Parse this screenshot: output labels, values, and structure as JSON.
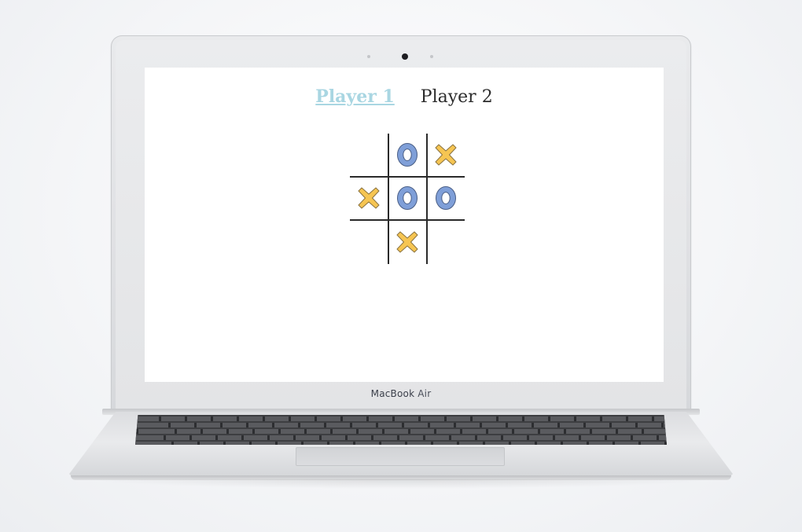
{
  "device": {
    "brand": "MacBook",
    "model": "Air"
  },
  "game": {
    "players": [
      {
        "label": "Player 1",
        "active": true
      },
      {
        "label": "Player 2",
        "active": false
      }
    ],
    "board": [
      [
        "",
        "O",
        "X"
      ],
      [
        "X",
        "O",
        "O"
      ],
      [
        "",
        "X",
        ""
      ]
    ],
    "colors": {
      "x_fill": "#f6c552",
      "o_fill": "#7f9fd8",
      "active_player": "#a9d6e2"
    }
  }
}
